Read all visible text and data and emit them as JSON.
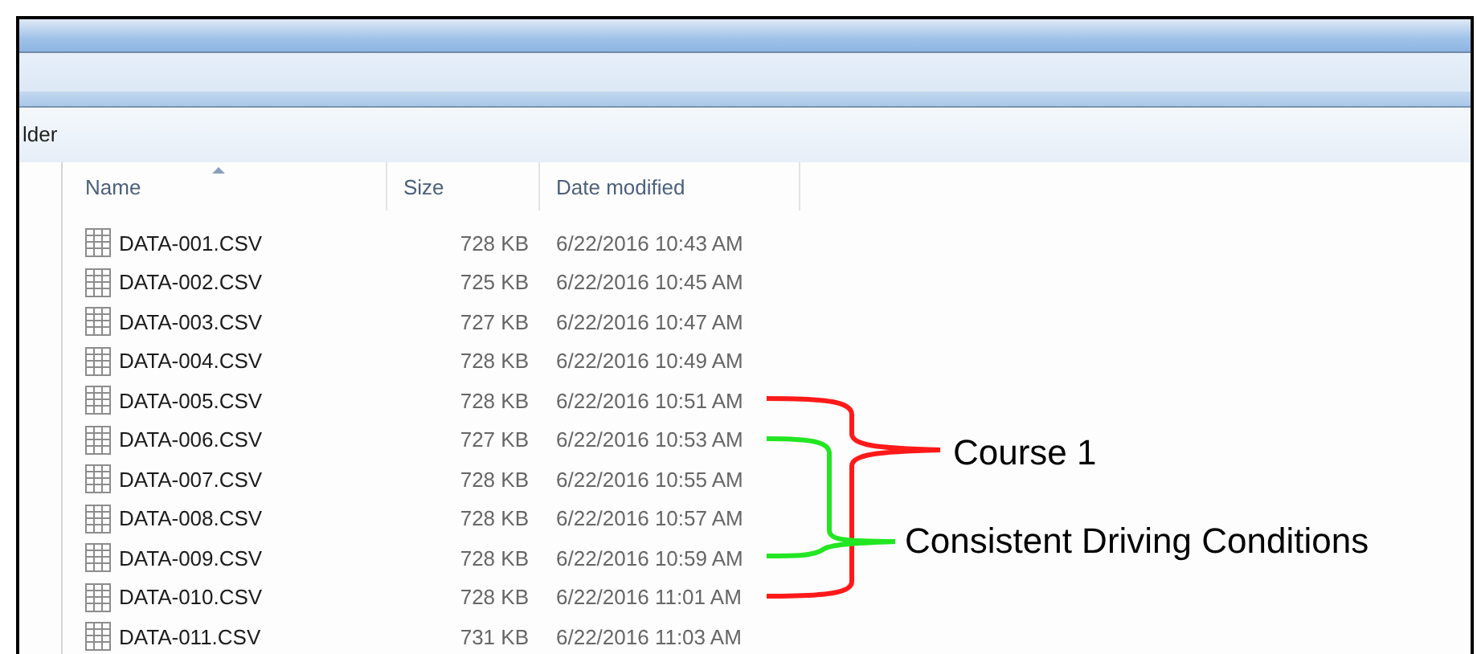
{
  "address_bar": {
    "text": "lder"
  },
  "columns": [
    {
      "label": "Name",
      "sorted": true
    },
    {
      "label": "Size",
      "sorted": false
    },
    {
      "label": "Date modified",
      "sorted": false
    }
  ],
  "rows": [
    {
      "name": "DATA-001.CSV",
      "size": "728 KB",
      "date": "6/22/2016 10:43 AM"
    },
    {
      "name": "DATA-002.CSV",
      "size": "725 KB",
      "date": "6/22/2016 10:45 AM"
    },
    {
      "name": "DATA-003.CSV",
      "size": "727 KB",
      "date": "6/22/2016 10:47 AM"
    },
    {
      "name": "DATA-004.CSV",
      "size": "728 KB",
      "date": "6/22/2016 10:49 AM"
    },
    {
      "name": "DATA-005.CSV",
      "size": "728 KB",
      "date": "6/22/2016 10:51 AM"
    },
    {
      "name": "DATA-006.CSV",
      "size": "727 KB",
      "date": "6/22/2016 10:53 AM"
    },
    {
      "name": "DATA-007.CSV",
      "size": "728 KB",
      "date": "6/22/2016 10:55 AM"
    },
    {
      "name": "DATA-008.CSV",
      "size": "728 KB",
      "date": "6/22/2016 10:57 AM"
    },
    {
      "name": "DATA-009.CSV",
      "size": "728 KB",
      "date": "6/22/2016 10:59 AM"
    },
    {
      "name": "DATA-010.CSV",
      "size": "728 KB",
      "date": "6/22/2016 11:01 AM"
    },
    {
      "name": "DATA-011.CSV",
      "size": "731 KB",
      "date": "6/22/2016 11:03 AM"
    }
  ],
  "annotations": [
    {
      "label": "Course 1",
      "color": "#ff1a1a"
    },
    {
      "label": "Consistent Driving Conditions",
      "color": "#22e622"
    }
  ]
}
